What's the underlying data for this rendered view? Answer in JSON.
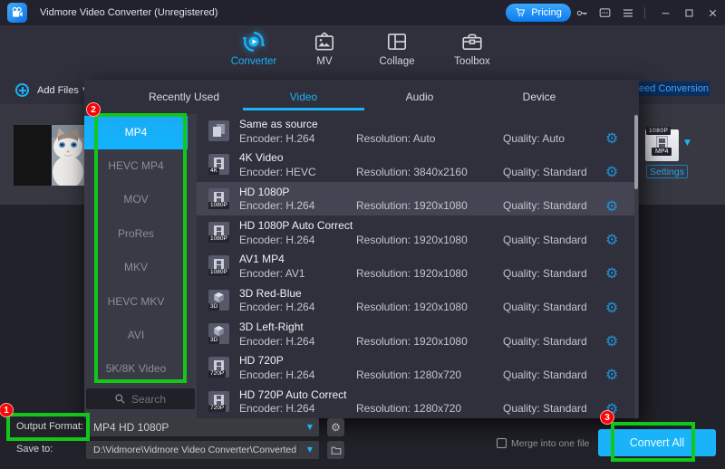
{
  "titlebar": {
    "title": "Vidmore Video Converter (Unregistered)",
    "pricing_label": "Pricing"
  },
  "nav": {
    "tabs": [
      {
        "label": "Converter",
        "active": true
      },
      {
        "label": "MV",
        "active": false
      },
      {
        "label": "Collage",
        "active": false
      },
      {
        "label": "Toolbox",
        "active": false
      }
    ]
  },
  "toolbar": {
    "add_files_label": "Add Files"
  },
  "speed_banner": {
    "label": "eed Conversion"
  },
  "file_card": {
    "resolution_badge": "1080P",
    "format_badge": "MP4",
    "settings_label": "Settings"
  },
  "panel": {
    "tabs": [
      "Recently Used",
      "Video",
      "Audio",
      "Device"
    ],
    "active_tab": "Video",
    "sidebar": {
      "items": [
        "MP4",
        "HEVC MP4",
        "MOV",
        "ProRes",
        "MKV",
        "HEVC MKV",
        "AVI",
        "5K/8K Video"
      ],
      "selected": "MP4",
      "search_placeholder": "Search"
    },
    "formats": [
      {
        "title": "Same as source",
        "encoder": "Encoder: H.264",
        "resolution": "Resolution: Auto",
        "quality": "Quality: Auto",
        "icon": "copy",
        "badge": "",
        "highlighted": false
      },
      {
        "title": "4K Video",
        "encoder": "Encoder: HEVC",
        "resolution": "Resolution: 3840x2160",
        "quality": "Quality: Standard",
        "icon": "film",
        "badge": "4K",
        "highlighted": false
      },
      {
        "title": "HD 1080P",
        "encoder": "Encoder: H.264",
        "resolution": "Resolution: 1920x1080",
        "quality": "Quality: Standard",
        "icon": "film",
        "badge": "1080P",
        "highlighted": true
      },
      {
        "title": "HD 1080P Auto Correct",
        "encoder": "Encoder: H.264",
        "resolution": "Resolution: 1920x1080",
        "quality": "Quality: Standard",
        "icon": "film",
        "badge": "1080P",
        "highlighted": false
      },
      {
        "title": "AV1 MP4",
        "encoder": "Encoder: AV1",
        "resolution": "Resolution: 1920x1080",
        "quality": "Quality: Standard",
        "icon": "film",
        "badge": "1080P",
        "highlighted": false
      },
      {
        "title": "3D Red-Blue",
        "encoder": "Encoder: H.264",
        "resolution": "Resolution: 1920x1080",
        "quality": "Quality: Standard",
        "icon": "cube",
        "badge": "3D",
        "highlighted": false
      },
      {
        "title": "3D Left-Right",
        "encoder": "Encoder: H.264",
        "resolution": "Resolution: 1920x1080",
        "quality": "Quality: Standard",
        "icon": "cube",
        "badge": "3D",
        "highlighted": false
      },
      {
        "title": "HD 720P",
        "encoder": "Encoder: H.264",
        "resolution": "Resolution: 1280x720",
        "quality": "Quality: Standard",
        "icon": "film",
        "badge": "720P",
        "highlighted": false
      },
      {
        "title": "HD 720P Auto Correct",
        "encoder": "Encoder: H.264",
        "resolution": "Resolution: 1280x720",
        "quality": "Quality: Standard",
        "icon": "film",
        "badge": "720P",
        "highlighted": false
      }
    ]
  },
  "bottom_bar": {
    "output_format_label": "Output Format:",
    "output_format_value": "MP4 HD 1080P",
    "save_to_label": "Save to:",
    "save_to_value": "D:\\Vidmore\\Vidmore Video Converter\\Converted",
    "merge_label": "Merge into one file",
    "convert_all_label": "Convert All"
  },
  "annotations": {
    "steps": [
      "1",
      "2",
      "3"
    ]
  }
}
